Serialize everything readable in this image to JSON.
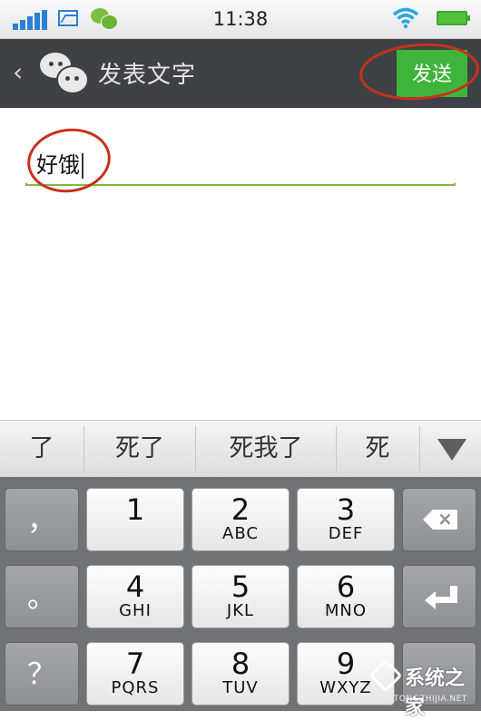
{
  "status_bar": {
    "time": "11:38",
    "icons": [
      "signal-icon",
      "image-icon",
      "wechat-notification-icon",
      "wifi-icon",
      "battery-icon"
    ]
  },
  "header": {
    "back_label": "‹",
    "title": "发表文字",
    "send_label": "发送",
    "background": "#3e4246",
    "send_color": "#3fb43a"
  },
  "editor": {
    "text": "好饿",
    "underline_color": "#7cbc3c"
  },
  "annotations": {
    "circle_color": "#c9301c"
  },
  "candidates": {
    "items": [
      "了",
      "死了",
      "死我了",
      "死"
    ],
    "expand_icon": "triangle-down-icon"
  },
  "keyboard": {
    "rows": [
      [
        {
          "type": "fn",
          "main": "，"
        },
        {
          "type": "num",
          "main": "1",
          "sub": ""
        },
        {
          "type": "num",
          "main": "2",
          "sub": "ABC"
        },
        {
          "type": "num",
          "main": "3",
          "sub": "DEF"
        },
        {
          "type": "fn",
          "main": "",
          "icon": "backspace-icon"
        }
      ],
      [
        {
          "type": "fn",
          "main": "。"
        },
        {
          "type": "num",
          "main": "4",
          "sub": "GHI"
        },
        {
          "type": "num",
          "main": "5",
          "sub": "JKL"
        },
        {
          "type": "num",
          "main": "6",
          "sub": "MNO"
        },
        {
          "type": "fn",
          "main": "",
          "icon": "enter-icon"
        }
      ],
      [
        {
          "type": "fn",
          "main": "？"
        },
        {
          "type": "num",
          "main": "7",
          "sub": "PQRS"
        },
        {
          "type": "num",
          "main": "8",
          "sub": "TUV"
        },
        {
          "type": "num",
          "main": "9",
          "sub": "WXYZ"
        },
        {
          "type": "fn",
          "main": "",
          "icon": "symbols-key"
        }
      ]
    ]
  },
  "watermark": {
    "text": "系统之家",
    "url": "XITONGZHIJIA.NET"
  }
}
